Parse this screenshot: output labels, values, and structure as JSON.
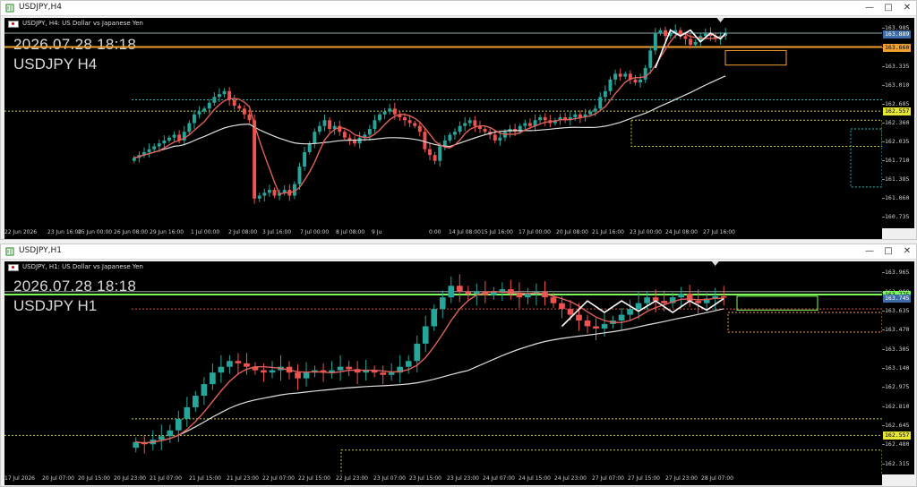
{
  "top": {
    "window_title": "USDJPY,H4",
    "symbol_desc": "USDJPY, H4: US Dollar vs Japanese Yen",
    "overlay_datetime": "2026.07.28 18:18",
    "overlay_symbol": "USDJPY H4",
    "price_ticks": [
      "163.985",
      "163.660",
      "163.335",
      "163.010",
      "162.685",
      "162.360",
      "162.035",
      "161.710",
      "161.385",
      "161.060",
      "160.735"
    ],
    "price_tags": {
      "current_white": "163.889",
      "orange_line": "163.660",
      "yellow_line": "162.557"
    },
    "time_labels": [
      "22 Jun 2026",
      "23 Jun 16:00",
      "25 Jun 00:00",
      "26 Jun 08:00",
      "29 Jun 16:00",
      "1 Jul 00:00",
      "2 Jul 08:00",
      "3 Jul 16:00",
      "7 Jul 00:00",
      "8 Jul 08:00",
      "9 Ju",
      "0:00",
      "14 Jul 08:00",
      "15 Jul 16:00",
      "17 Jul 00:00",
      "20 Jul 08:00",
      "21 Jul 16:00",
      "23 Jul 00:00",
      "24 Jul 08:00",
      "27 Jul 16:00"
    ],
    "chart_data": {
      "type": "candlestick",
      "title": "USDJPY H4",
      "ylim": [
        160.6,
        164.1
      ],
      "closes": [
        161.75,
        161.8,
        161.85,
        161.9,
        161.95,
        162.0,
        162.05,
        162.1,
        162.15,
        162.05,
        162.2,
        162.35,
        162.5,
        162.55,
        162.6,
        162.7,
        162.8,
        162.85,
        162.9,
        162.75,
        162.65,
        162.6,
        162.5,
        162.4,
        161.05,
        161.1,
        161.15,
        161.2,
        161.1,
        161.15,
        161.2,
        161.1,
        161.3,
        161.6,
        161.85,
        162.0,
        162.2,
        162.3,
        162.4,
        162.25,
        162.3,
        162.2,
        162.1,
        162.05,
        162.0,
        162.1,
        162.15,
        162.25,
        162.4,
        162.5,
        162.55,
        162.6,
        162.5,
        162.45,
        162.4,
        162.35,
        162.3,
        162.2,
        161.9,
        161.8,
        161.7,
        161.95,
        162.05,
        162.15,
        162.2,
        162.3,
        162.35,
        162.4,
        162.3,
        162.25,
        162.2,
        162.15,
        162.05,
        162.1,
        162.2,
        162.25,
        162.2,
        162.3,
        162.35,
        162.3,
        162.4,
        162.45,
        162.4,
        162.35,
        162.4,
        162.45,
        162.4,
        162.45,
        162.5,
        162.45,
        162.5,
        162.55,
        162.6,
        162.8,
        162.9,
        163.1,
        163.2,
        163.15,
        163.2,
        163.1,
        163.05,
        163.1,
        163.3,
        163.6,
        163.9,
        163.95,
        163.85,
        163.9,
        163.95,
        163.85,
        163.8,
        163.7,
        163.75,
        163.85,
        163.9,
        163.85,
        163.8,
        163.85,
        163.9
      ],
      "series": [
        {
          "name": "MA fast",
          "color": "#e0605a"
        },
        {
          "name": "MA slow",
          "color": "#e0e0e0"
        }
      ]
    }
  },
  "bottom": {
    "window_title": "USDJPY,H1",
    "symbol_desc": "USDJPY, H1: US Dollar vs Japanese Yen",
    "overlay_datetime": "2026.07.28 18:18",
    "overlay_symbol": "USDJPY H1",
    "price_ticks": [
      "163.965",
      "163.800",
      "163.635",
      "163.470",
      "163.305",
      "163.140",
      "162.975",
      "162.810",
      "162.645",
      "162.480",
      "162.315"
    ],
    "price_tags": {
      "green_line": "163.775",
      "current_white": "163.745",
      "yellow_line": "162.557"
    },
    "time_labels": [
      "17 Jul 2026",
      "20 Jul 07:00",
      "20 Jul 15:00",
      "20 Jul 23:00",
      "21 Jul 07:00",
      "21 Jul 15:00",
      "21 Jul 23:00",
      "22 Jul 07:00",
      "22 Jul 15:00",
      "22 Jul 23:00",
      "23 Jul 07:00",
      "23 Jul 15:00",
      "23 Jul 23:00",
      "24 Jul 07:00",
      "24 Jul 15:00",
      "24 Jul 23:00",
      "27 Jul 07:00",
      "27 Jul 15:00",
      "27 Jul 23:00",
      "28 Jul 07:00"
    ],
    "chart_data": {
      "type": "candlestick",
      "title": "USDJPY H1",
      "ylim": [
        162.25,
        164.03
      ],
      "closes": [
        162.5,
        162.48,
        162.52,
        162.55,
        162.6,
        162.7,
        162.8,
        162.9,
        163.0,
        163.1,
        163.15,
        163.2,
        163.18,
        163.15,
        163.12,
        163.1,
        163.12,
        163.15,
        163.1,
        163.05,
        163.1,
        163.12,
        163.1,
        163.12,
        163.15,
        163.13,
        163.1,
        163.12,
        163.1,
        163.08,
        163.1,
        163.15,
        163.2,
        163.35,
        163.5,
        163.65,
        163.75,
        163.85,
        163.8,
        163.78,
        163.8,
        163.77,
        163.8,
        163.82,
        163.78,
        163.75,
        163.78,
        163.8,
        163.75,
        163.7,
        163.65,
        163.6,
        163.55,
        163.5,
        163.48,
        163.52,
        163.55,
        163.6,
        163.65,
        163.7,
        163.75,
        163.72,
        163.7,
        163.75,
        163.78,
        163.72,
        163.7,
        163.74,
        163.76,
        163.75
      ],
      "series": [
        {
          "name": "MA fast",
          "color": "#e0605a"
        },
        {
          "name": "MA slow",
          "color": "#e0e0e0"
        }
      ]
    }
  }
}
